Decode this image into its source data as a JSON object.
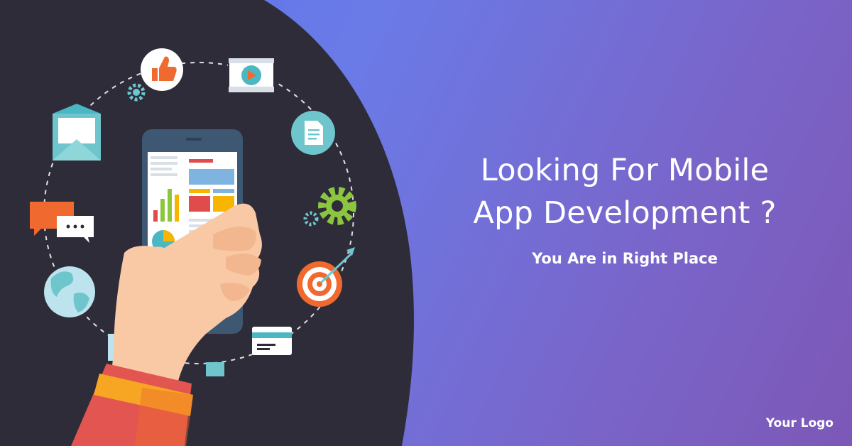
{
  "banner": {
    "headline_line1": "Looking For Mobile",
    "headline_line2": "App Development ?",
    "subheadline": "You Are in Right Place",
    "logo_text": "Your Logo"
  },
  "colors": {
    "background_start": "#5b6ee6",
    "background_end": "#7c58b7",
    "dark_panel": "#2f2c3a",
    "text": "#ffffff",
    "accent_orange": "#f06a2f",
    "accent_teal": "#6ec6cc",
    "accent_green": "#8cc63f"
  },
  "icons": [
    "thumbs-up-icon",
    "video-player-icon",
    "document-icon",
    "gear-icon",
    "target-icon",
    "credit-card-icon",
    "globe-icon",
    "chat-bubble-icon",
    "envelope-icon"
  ]
}
